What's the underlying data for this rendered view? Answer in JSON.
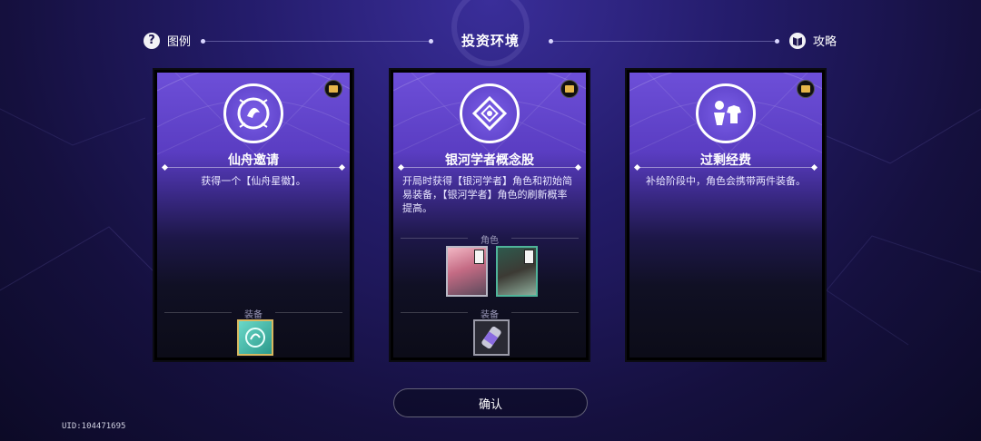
{
  "header": {
    "legend_label": "图例",
    "title": "投资环境",
    "guide_label": "攻略"
  },
  "cards": [
    {
      "name": "仙舟邀请",
      "description": "获得一个【仙舟星徽】。",
      "equipment_label": "装备",
      "emblem_icon": "xianzhou-emblem-icon"
    },
    {
      "name": "银河学者概念股",
      "description": "开局时获得【银河学者】角色和初始简易装备，【银河学者】角色的刷新概率提高。",
      "character_label": "角色",
      "equipment_label": "装备",
      "emblem_icon": "scholar-diamond-icon"
    },
    {
      "name": "过剩经费",
      "description": "补给阶段中，角色会携带两件装备。",
      "emblem_icon": "people-clothes-icon"
    }
  ],
  "confirm_label": "确认",
  "uid": "UID:104471695",
  "colors": {
    "accent": "#6d4fd8",
    "badge": "#e6b64a",
    "background": "#15103e"
  }
}
